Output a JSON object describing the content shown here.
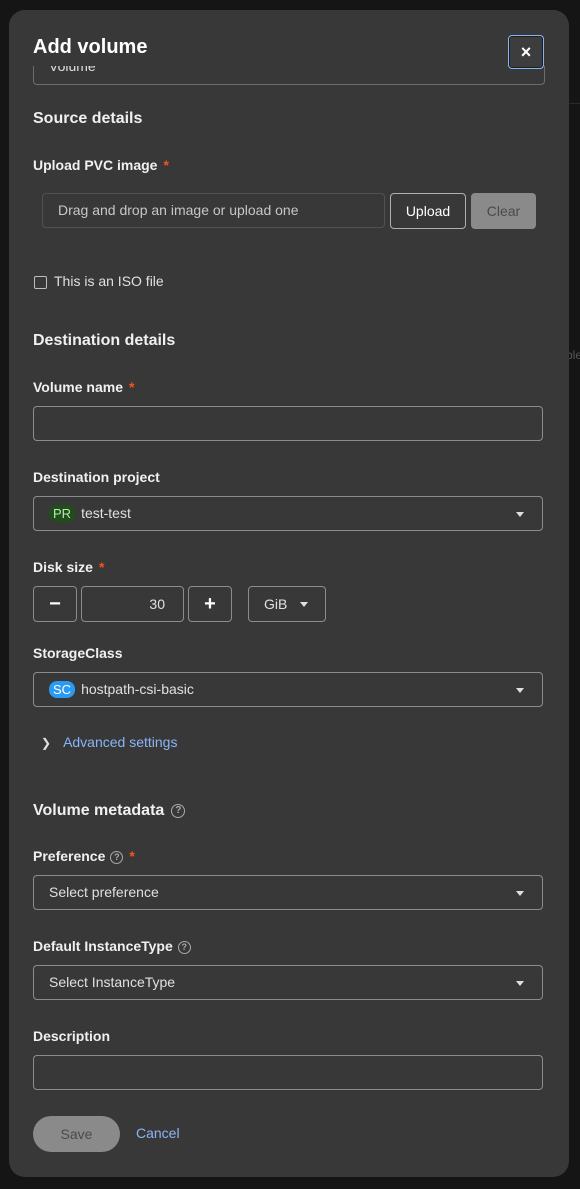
{
  "modal": {
    "title": "Add volume",
    "close_label": "×",
    "top_select_value": "Volume"
  },
  "backdrop": {
    "fragment_text": "ble"
  },
  "source": {
    "heading": "Source details",
    "upload_label": "Upload PVC image",
    "required_mark": "*",
    "drop_placeholder": "Drag and drop an image or upload one",
    "upload_button": "Upload",
    "clear_button": "Clear",
    "iso_checkbox_label": "This is an ISO file"
  },
  "destination": {
    "heading": "Destination details",
    "volume_name_label": "Volume name",
    "volume_name_value": "",
    "project_label": "Destination project",
    "project_badge": "PR",
    "project_value": "test-test",
    "disk_size_label": "Disk size",
    "disk_size_value": "30",
    "minus": "−",
    "plus": "+",
    "unit": "GiB",
    "storageclass_label": "StorageClass",
    "storageclass_badge": "SC",
    "storageclass_value": "hostpath-csi-basic",
    "advanced_label": "Advanced settings"
  },
  "metadata": {
    "heading": "Volume metadata",
    "preference_label": "Preference",
    "preference_placeholder": "Select preference",
    "instancetype_label": "Default InstanceType",
    "instancetype_placeholder": "Select InstanceType",
    "description_label": "Description",
    "description_value": "",
    "help_glyph": "?"
  },
  "footer": {
    "save": "Save",
    "cancel": "Cancel"
  },
  "colors": {
    "accent_link": "#8ab4f8",
    "required": "#f0561d",
    "panel": "#383838"
  }
}
